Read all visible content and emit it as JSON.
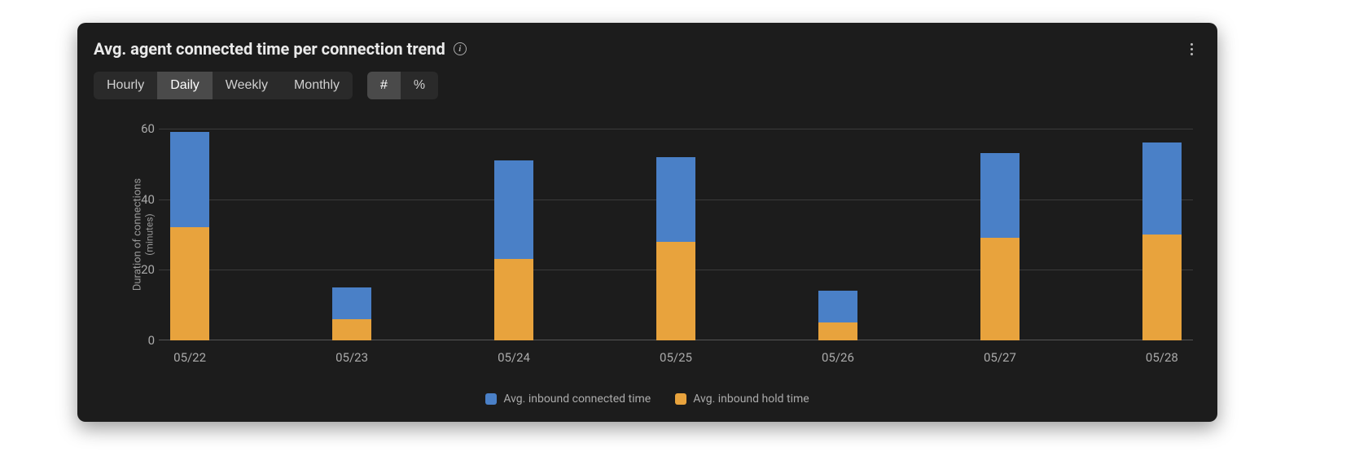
{
  "title": "Avg. agent connected time per connection trend",
  "controls": {
    "granularity": {
      "options": [
        "Hourly",
        "Daily",
        "Weekly",
        "Monthly"
      ],
      "active": "Daily"
    },
    "mode": {
      "options": [
        "#",
        "%"
      ],
      "active": "#"
    }
  },
  "yaxis": {
    "title": "Duration of connections",
    "subtitle": "(minutes)"
  },
  "legend": {
    "series1": "Avg. inbound connected time",
    "series2": "Avg. inbound hold time"
  },
  "chart_data": {
    "type": "bar",
    "stacked": true,
    "categories": [
      "05/22",
      "05/23",
      "05/24",
      "05/25",
      "05/26",
      "05/27",
      "05/28"
    ],
    "series": [
      {
        "name": "Avg. inbound connected time",
        "color": "#4a80c7",
        "values": [
          27,
          9,
          28,
          24,
          9,
          24,
          26
        ]
      },
      {
        "name": "Avg. inbound hold time",
        "color": "#e8a33d",
        "values": [
          32,
          6,
          23,
          28,
          5,
          29,
          30
        ]
      }
    ],
    "title": "Avg. agent connected time per connection trend",
    "xlabel": "",
    "ylabel": "Duration of connections (minutes)",
    "ylim": [
      0,
      60
    ],
    "yticks": [
      0,
      20,
      40,
      60
    ]
  }
}
